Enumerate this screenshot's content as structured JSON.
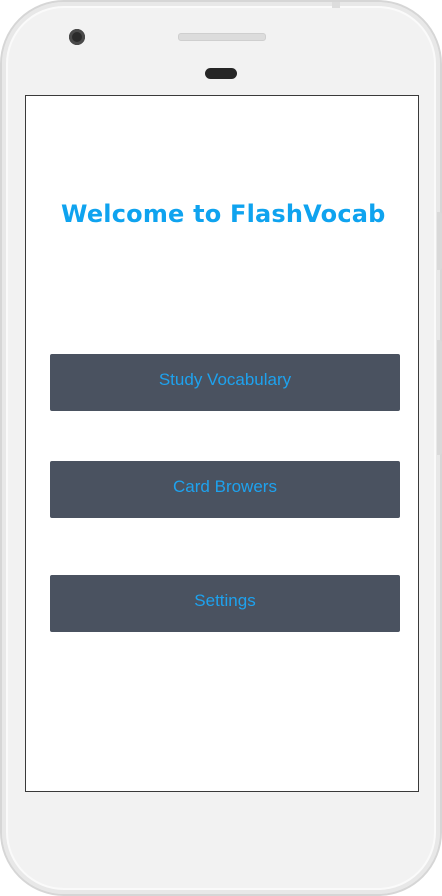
{
  "app": {
    "title": "Welcome to FlashVocab"
  },
  "menu": {
    "items": [
      {
        "label": "Study Vocabulary"
      },
      {
        "label": "Card Browers"
      },
      {
        "label": "Settings"
      }
    ]
  },
  "colors": {
    "title": "#0fa3ef",
    "button_bg": "#4a5260",
    "button_text": "#1ea2ee"
  }
}
